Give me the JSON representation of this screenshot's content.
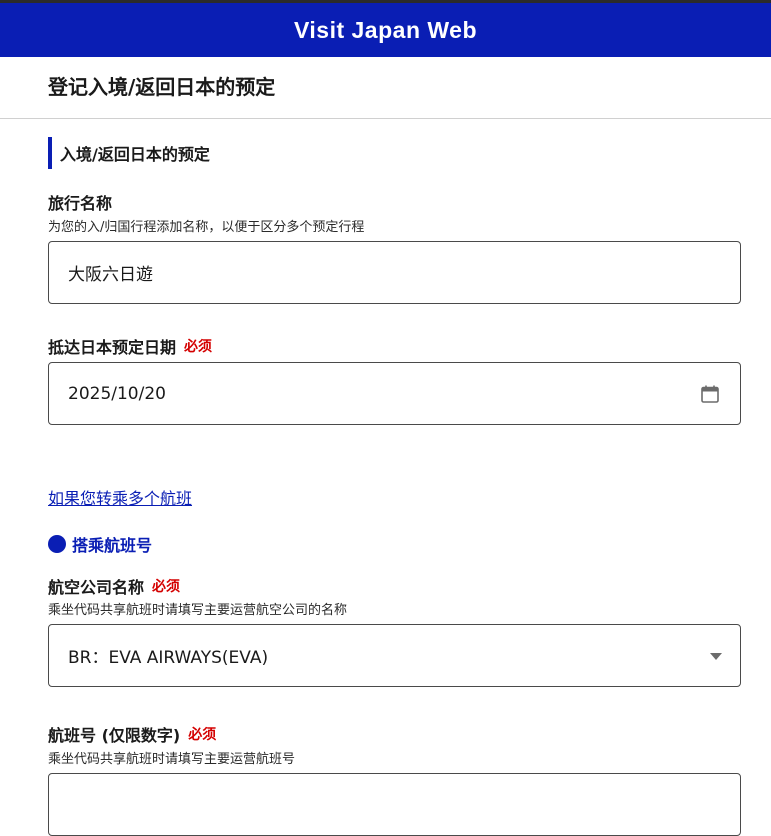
{
  "header": {
    "title": "Visit Japan Web"
  },
  "page": {
    "title": "登记入境/返回日本的预定"
  },
  "section": {
    "title": "入境/返回日本的预定"
  },
  "trip_name": {
    "label": "旅行名称",
    "hint": "为您的入/归国行程添加名称，以便于区分多个预定行程",
    "value": "大阪六日遊"
  },
  "arrival_date": {
    "label": "抵达日本预定日期",
    "required": "必须",
    "value": "2025/10/20",
    "icon": "calendar-icon"
  },
  "transfer_link": "如果您转乘多个航班",
  "flight_section": {
    "title": "搭乘航班号"
  },
  "airline": {
    "label": "航空公司名称",
    "required": "必须",
    "hint": "乘坐代码共享航班时请填写主要运营航空公司的名称",
    "value": "BR：EVA AIRWAYS(EVA)",
    "icon": "chevron-down-icon"
  },
  "flight_number": {
    "label": "航班号 (仅限数字)",
    "required": "必须",
    "hint": "乘坐代码共享航班时请填写主要运营航班号"
  },
  "colors": {
    "brand_blue": "#0a1eb4",
    "required_red": "#d40000"
  }
}
